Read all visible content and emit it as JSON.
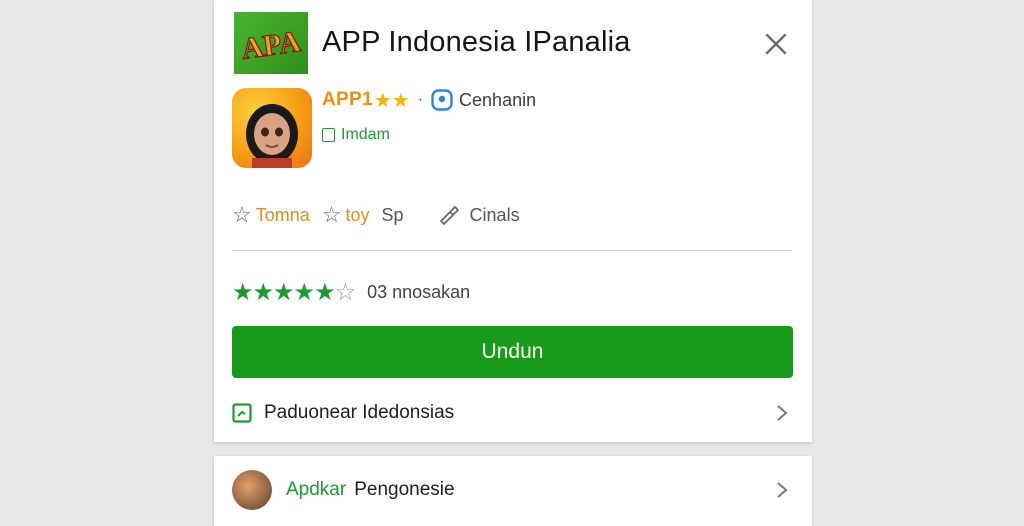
{
  "app": {
    "title": "APP Indonesia IPanalia",
    "logo_text": "APA",
    "name": "APP1",
    "gold_stars": "★★",
    "developer": "Cenhanin",
    "badge": "Imdam"
  },
  "actions": {
    "first_label": "Tomna",
    "second_label": "toy",
    "third_label": "Sp",
    "share_label": "Cinals"
  },
  "rating": {
    "stars_filled": "★★★★★",
    "stars_empty": "☆",
    "text": "03 nnosakan"
  },
  "download_label": "Undun",
  "link_row": {
    "label": "Paduonear Idedonsias"
  },
  "second_card": {
    "green_label": "Apdkar",
    "label": "Pengonesie"
  },
  "colors": {
    "accent_green": "#1a9a1a",
    "orange": "#f08c14",
    "gold": "#f4b400"
  },
  "icons": [
    "close-icon",
    "star-outline-icon",
    "share-icon",
    "chevron-right-icon",
    "location-pin-icon",
    "document-icon"
  ]
}
